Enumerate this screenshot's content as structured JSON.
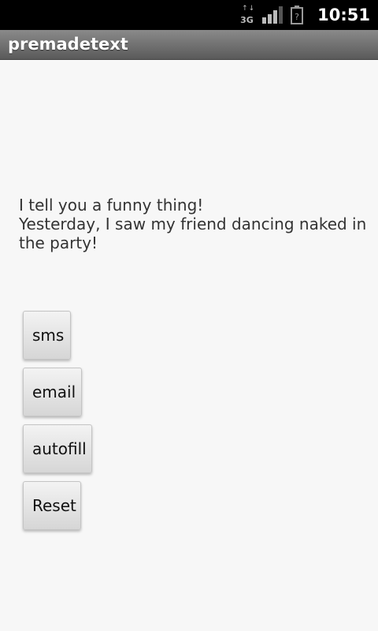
{
  "status_bar": {
    "network_label": "3G",
    "network_arrows": "↑↓",
    "time": "10:51",
    "icons": [
      "network-3g-icon",
      "signal-icon",
      "battery-icon"
    ]
  },
  "app": {
    "title": "premadetext"
  },
  "main": {
    "message_lines": [
      "I tell you a funny thing!",
      "Yesterday, I saw my friend dancing naked in",
      "the party!"
    ]
  },
  "buttons": {
    "sms": "sms",
    "email": "email",
    "autofill": "autofill",
    "reset": "Reset"
  },
  "colors": {
    "background": "#f7f7f7",
    "status_bar": "#000000",
    "title_bar": "#6f6f6f",
    "text": "#333333"
  }
}
